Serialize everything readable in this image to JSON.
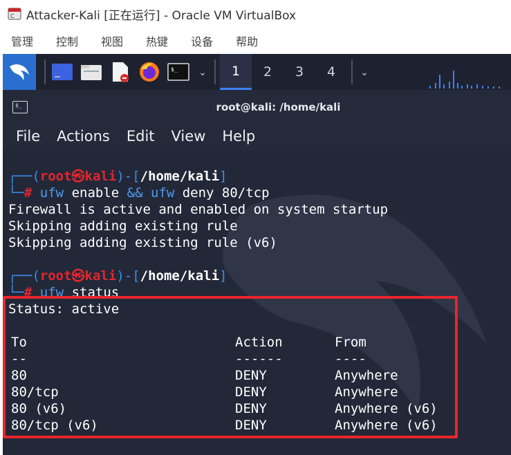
{
  "host": {
    "title": "Attacker-Kali [正在运行] - Oracle VM VirtualBox",
    "menu": [
      "管理",
      "控制",
      "视图",
      "热键",
      "设备",
      "帮助"
    ]
  },
  "panel": {
    "workspaces": [
      "1",
      "2",
      "3",
      "4"
    ],
    "active_workspace": "1",
    "icons": [
      "kali-menu-icon",
      "desktop-icon",
      "file-manager-icon",
      "text-editor-icon",
      "firefox-icon",
      "terminal-icon"
    ]
  },
  "terminal": {
    "title": "root@kali: /home/kali",
    "menu": [
      "File",
      "Actions",
      "Edit",
      "View",
      "Help"
    ],
    "prompt1": {
      "user": "root",
      "at": "㉿",
      "host": "kali",
      "path": "/home/kali",
      "command_name": "ufw",
      "command_args": " enable ",
      "and": "&&",
      "command_name2": " ufw",
      "command_args2": " deny 80/tcp"
    },
    "output1": [
      "Firewall is active and enabled on system startup",
      "Skipping adding existing rule",
      "Skipping adding existing rule (v6)"
    ],
    "prompt2": {
      "user": "root",
      "at": "㉿",
      "host": "kali",
      "path": "/home/kali",
      "command_name": "ufw",
      "command_args": " status"
    },
    "status_line": "Status: active",
    "table": {
      "headers": [
        "To",
        "Action",
        "From"
      ],
      "underlines": [
        "--",
        "------",
        "----"
      ],
      "rows": [
        [
          "80",
          "DENY",
          "Anywhere"
        ],
        [
          "80/tcp",
          "DENY",
          "Anywhere"
        ],
        [
          "80 (v6)",
          "DENY",
          "Anywhere (v6)"
        ],
        [
          "80/tcp (v6)",
          "DENY",
          "Anywhere (v6)"
        ]
      ]
    },
    "highlight_color": "#e6262c"
  }
}
